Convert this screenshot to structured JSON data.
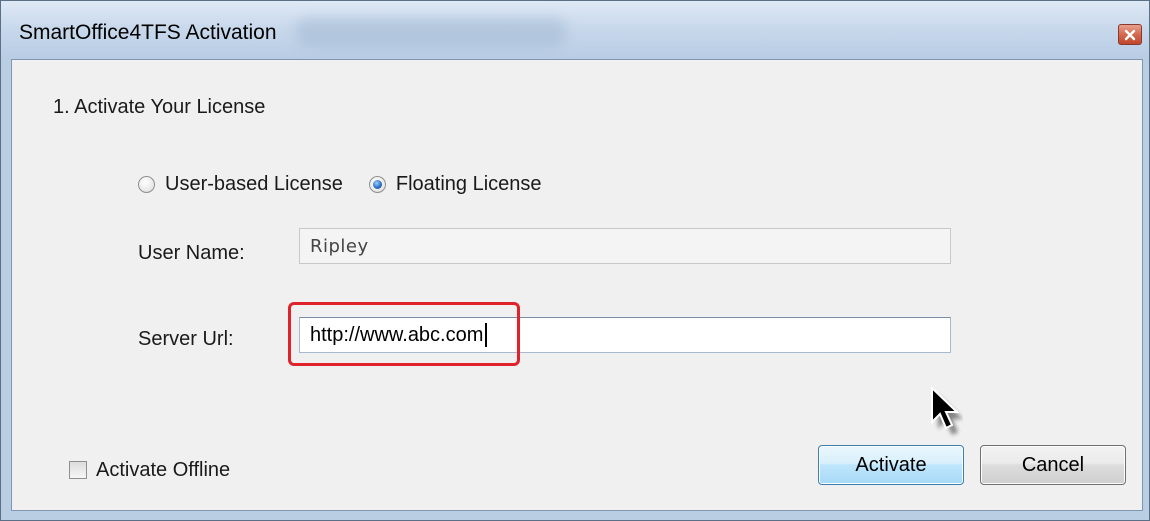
{
  "window": {
    "title": "SmartOffice4TFS Activation",
    "close_icon": "close-icon"
  },
  "section": {
    "title": "1. Activate Your License"
  },
  "license_type": {
    "options": [
      {
        "label": "User-based License",
        "selected": false
      },
      {
        "label": "Floating License",
        "selected": true
      }
    ]
  },
  "user_name": {
    "label": "User Name:",
    "value": "Ripley"
  },
  "server_url": {
    "label": "Server Url:",
    "value": "http://www.abc.com"
  },
  "offline": {
    "label": "Activate Offline",
    "checked": false
  },
  "buttons": {
    "activate": "Activate",
    "cancel": "Cancel"
  },
  "colors": {
    "highlight": "#e0222a",
    "titlebar": "#c9d9ec",
    "client_bg": "#f0f0f0"
  }
}
